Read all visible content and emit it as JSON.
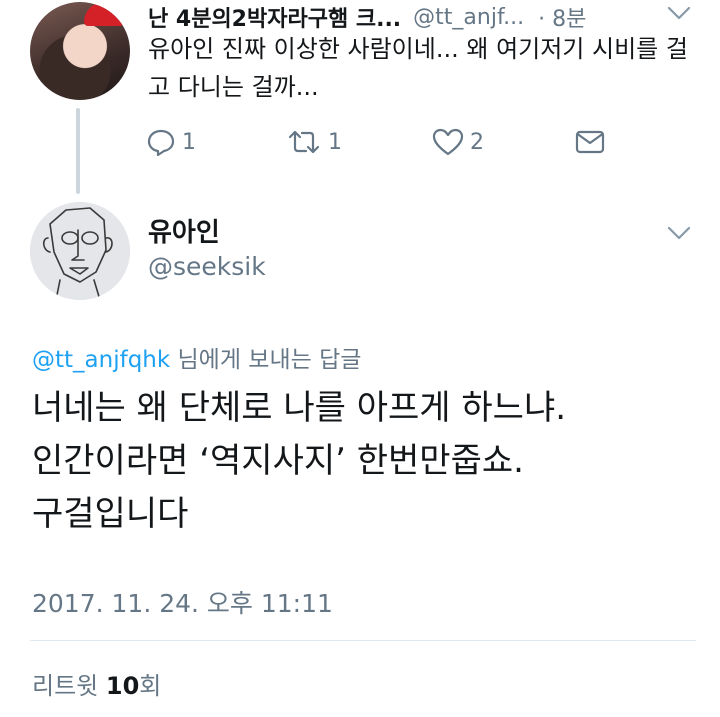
{
  "parent_tweet": {
    "display_name": "난 4분의2박자라구햄 크...",
    "handle": "@tt_anjf...",
    "time": "· 8분",
    "text": "유아인 진짜 이상한 사람이네... 왜 여기저기 시비를 걸고 다니는 걸까...",
    "reply_count": "1",
    "retweet_count": "1",
    "like_count": "2"
  },
  "main_tweet": {
    "display_name": "유아인",
    "handle": "@seeksik",
    "reply_to_mention": "@tt_anjfqhk",
    "reply_to_suffix": "님에게 보내는 답글",
    "text_lines": [
      "너네는 왜 단체로 나를 아프게 하느냐.",
      "인간이라면 ‘역지사지’ 한번만줍쇼.",
      "구걸입니다"
    ],
    "timestamp": "2017. 11. 24. 오후 11:11",
    "retweets_label": "리트윗",
    "retweets_count": "10",
    "retweets_suffix": "회"
  },
  "icons": {
    "reply": "reply-icon",
    "retweet": "retweet-icon",
    "like": "heart-icon",
    "dm": "envelope-icon",
    "menu": "chevron-down-icon"
  },
  "colors": {
    "mention": "#1da1f2",
    "secondary_text": "#657786",
    "primary_text": "#14171a"
  }
}
